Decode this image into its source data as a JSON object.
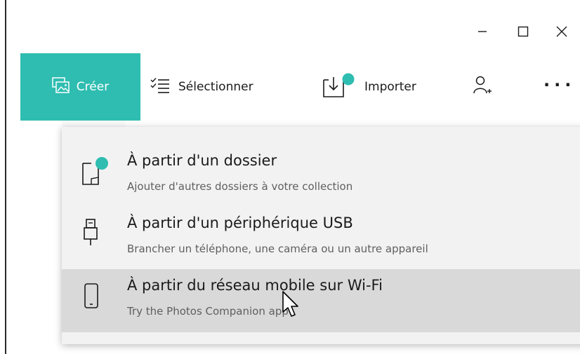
{
  "window": {
    "controls": [
      {
        "name": "minimize",
        "icon": "minimize-icon"
      },
      {
        "name": "maximize",
        "icon": "maximize-icon"
      },
      {
        "name": "close",
        "icon": "close-icon"
      }
    ]
  },
  "toolbar": {
    "create_label": "Créer",
    "select_label": "Sélectionner",
    "import_label": "Importer",
    "more_label": "···",
    "accent_color": "#2ebdb0"
  },
  "import_menu": {
    "items": [
      {
        "title": "À partir d'un dossier",
        "subtitle": "Ajouter d'autres dossiers à votre collection",
        "icon": "folder-icon"
      },
      {
        "title": "À partir d'un périphérique USB",
        "subtitle": "Brancher un téléphone, une caméra ou un autre appareil",
        "icon": "usb-icon"
      },
      {
        "title": "À partir du réseau mobile sur Wi-Fi",
        "subtitle": "Try the Photos Companion app",
        "icon": "phone-icon",
        "hovered": true
      }
    ]
  }
}
